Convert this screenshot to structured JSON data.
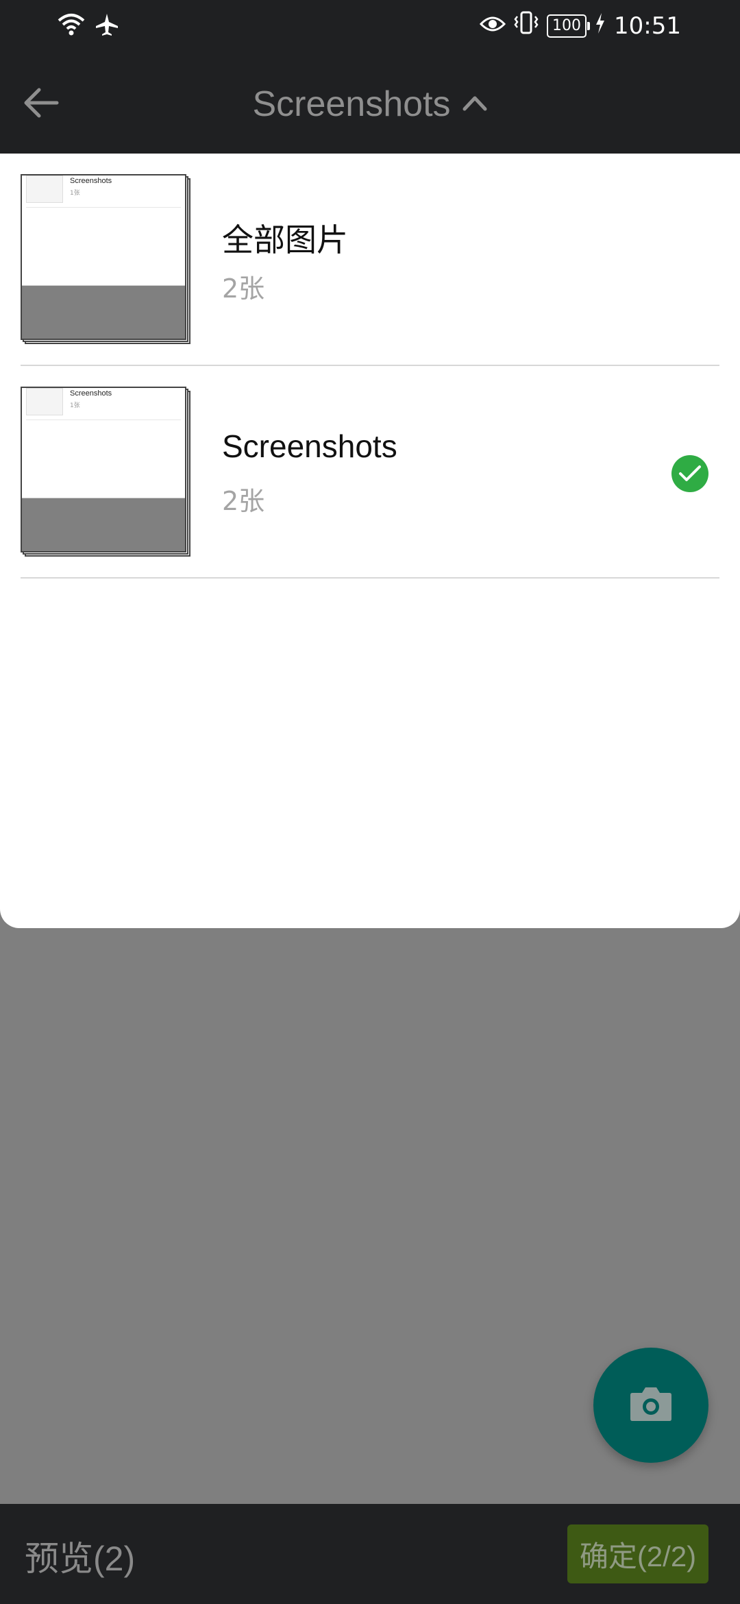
{
  "status_bar": {
    "time": "10:51",
    "battery": "100",
    "icons": [
      "wifi-icon",
      "airplane-icon",
      "eye-icon",
      "vibrate-icon",
      "battery-icon",
      "charging-icon"
    ]
  },
  "header": {
    "title": "Screenshots"
  },
  "albums": [
    {
      "name": "全部图片",
      "count": "2张",
      "selected": false
    },
    {
      "name": "Screenshots",
      "count": "2张",
      "selected": true
    }
  ],
  "thumbnail_preview": {
    "title": "Screenshots",
    "count": "1张"
  },
  "bottom_bar": {
    "preview_label": "预览(2)",
    "confirm_label": "确定(2/2)"
  },
  "colors": {
    "bars": "#1f2022",
    "check": "#2fac44",
    "fab": "#005d58",
    "confirm_bg": "#3e5a14",
    "dim_overlay": "#7f7f7f"
  }
}
